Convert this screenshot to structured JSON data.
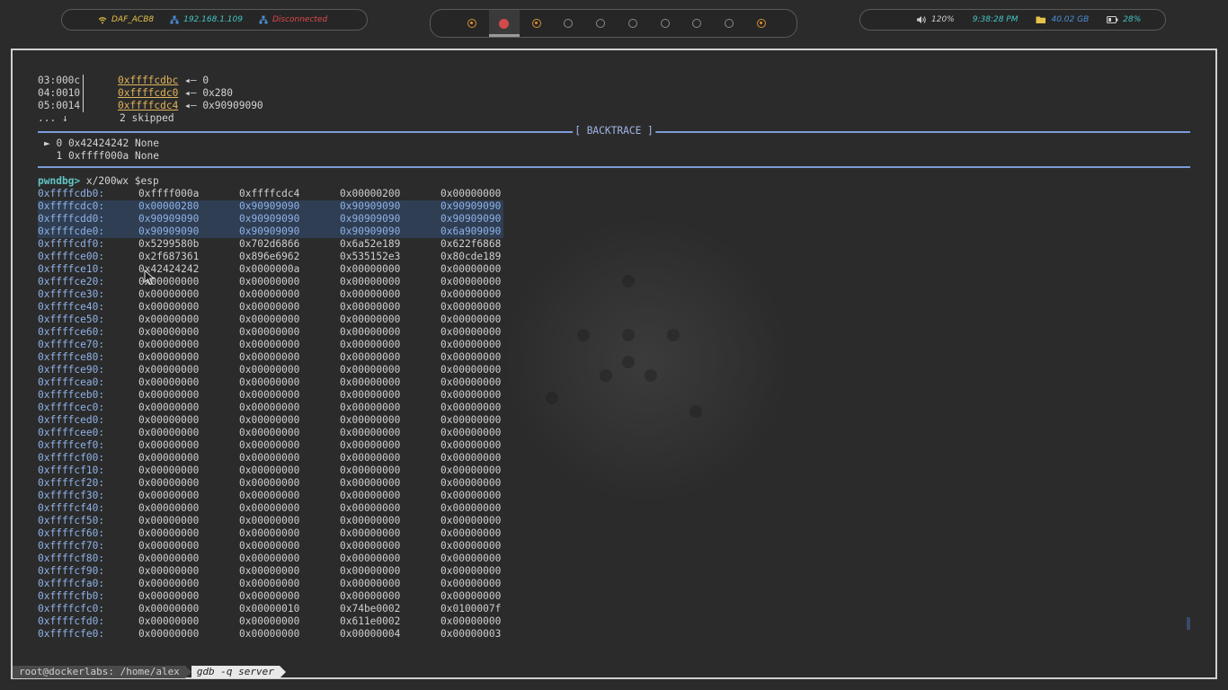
{
  "topbar": {
    "wifi_name": "DAF_ACB8",
    "ip": "192.168.1.109",
    "vpn_status": "Disconnected",
    "volume": "120%",
    "clock": "9:38:28 PM",
    "disk": "40.02 GB",
    "battery": "28%",
    "workspaces": [
      "occupied",
      "active",
      "occupied",
      "empty",
      "empty",
      "empty",
      "empty",
      "empty",
      "empty",
      "occupied"
    ]
  },
  "telescope": [
    {
      "idx": "03:000c",
      "addr": "0xffffcdbc",
      "value": "0"
    },
    {
      "idx": "04:0010",
      "addr": "0xffffcdc0",
      "value": "0x280"
    },
    {
      "idx": "05:0014",
      "addr": "0xffffcdc4",
      "value": "0x90909090"
    }
  ],
  "skipped": {
    "idx": "... ↓",
    "text": "2 skipped"
  },
  "backtrace": {
    "title": "[ BACKTRACE ]",
    "frames": [
      "► 0 0x42424242 None",
      "  1 0xffff000a None"
    ]
  },
  "prompt": {
    "label": "pwndbg>",
    "command": " x/200wx $esp"
  },
  "memory": [
    {
      "addr": "0xffffcdb0:",
      "vals": [
        "0xffff000a",
        "0xffffcdc4",
        "0x00000200",
        "0x00000000"
      ],
      "hl": false
    },
    {
      "addr": "0xffffcdc0:",
      "vals": [
        "0x00000280",
        "0x90909090",
        "0x90909090",
        "0x90909090"
      ],
      "hl": true
    },
    {
      "addr": "0xffffcdd0:",
      "vals": [
        "0x90909090",
        "0x90909090",
        "0x90909090",
        "0x90909090"
      ],
      "hl": true
    },
    {
      "addr": "0xffffcde0:",
      "vals": [
        "0x90909090",
        "0x90909090",
        "0x90909090",
        "0x6a909090"
      ],
      "hl": true
    },
    {
      "addr": "0xffffcdf0:",
      "vals": [
        "0x5299580b",
        "0x702d6866",
        "0x6a52e189",
        "0x622f6868"
      ],
      "hl": false
    },
    {
      "addr": "0xffffce00:",
      "vals": [
        "0x2f687361",
        "0x896e6962",
        "0x535152e3",
        "0x80cde189"
      ],
      "hl": false
    },
    {
      "addr": "0xffffce10:",
      "vals": [
        "0x42424242",
        "0x0000000a",
        "0x00000000",
        "0x00000000"
      ],
      "hl": false
    },
    {
      "addr": "0xffffce20:",
      "vals": [
        "0x00000000",
        "0x00000000",
        "0x00000000",
        "0x00000000"
      ],
      "hl": false
    },
    {
      "addr": "0xffffce30:",
      "vals": [
        "0x00000000",
        "0x00000000",
        "0x00000000",
        "0x00000000"
      ],
      "hl": false
    },
    {
      "addr": "0xffffce40:",
      "vals": [
        "0x00000000",
        "0x00000000",
        "0x00000000",
        "0x00000000"
      ],
      "hl": false
    },
    {
      "addr": "0xffffce50:",
      "vals": [
        "0x00000000",
        "0x00000000",
        "0x00000000",
        "0x00000000"
      ],
      "hl": false
    },
    {
      "addr": "0xffffce60:",
      "vals": [
        "0x00000000",
        "0x00000000",
        "0x00000000",
        "0x00000000"
      ],
      "hl": false
    },
    {
      "addr": "0xffffce70:",
      "vals": [
        "0x00000000",
        "0x00000000",
        "0x00000000",
        "0x00000000"
      ],
      "hl": false
    },
    {
      "addr": "0xffffce80:",
      "vals": [
        "0x00000000",
        "0x00000000",
        "0x00000000",
        "0x00000000"
      ],
      "hl": false
    },
    {
      "addr": "0xffffce90:",
      "vals": [
        "0x00000000",
        "0x00000000",
        "0x00000000",
        "0x00000000"
      ],
      "hl": false
    },
    {
      "addr": "0xffffcea0:",
      "vals": [
        "0x00000000",
        "0x00000000",
        "0x00000000",
        "0x00000000"
      ],
      "hl": false
    },
    {
      "addr": "0xffffceb0:",
      "vals": [
        "0x00000000",
        "0x00000000",
        "0x00000000",
        "0x00000000"
      ],
      "hl": false
    },
    {
      "addr": "0xffffcec0:",
      "vals": [
        "0x00000000",
        "0x00000000",
        "0x00000000",
        "0x00000000"
      ],
      "hl": false
    },
    {
      "addr": "0xffffced0:",
      "vals": [
        "0x00000000",
        "0x00000000",
        "0x00000000",
        "0x00000000"
      ],
      "hl": false
    },
    {
      "addr": "0xffffcee0:",
      "vals": [
        "0x00000000",
        "0x00000000",
        "0x00000000",
        "0x00000000"
      ],
      "hl": false
    },
    {
      "addr": "0xffffcef0:",
      "vals": [
        "0x00000000",
        "0x00000000",
        "0x00000000",
        "0x00000000"
      ],
      "hl": false
    },
    {
      "addr": "0xffffcf00:",
      "vals": [
        "0x00000000",
        "0x00000000",
        "0x00000000",
        "0x00000000"
      ],
      "hl": false
    },
    {
      "addr": "0xffffcf10:",
      "vals": [
        "0x00000000",
        "0x00000000",
        "0x00000000",
        "0x00000000"
      ],
      "hl": false
    },
    {
      "addr": "0xffffcf20:",
      "vals": [
        "0x00000000",
        "0x00000000",
        "0x00000000",
        "0x00000000"
      ],
      "hl": false
    },
    {
      "addr": "0xffffcf30:",
      "vals": [
        "0x00000000",
        "0x00000000",
        "0x00000000",
        "0x00000000"
      ],
      "hl": false
    },
    {
      "addr": "0xffffcf40:",
      "vals": [
        "0x00000000",
        "0x00000000",
        "0x00000000",
        "0x00000000"
      ],
      "hl": false
    },
    {
      "addr": "0xffffcf50:",
      "vals": [
        "0x00000000",
        "0x00000000",
        "0x00000000",
        "0x00000000"
      ],
      "hl": false
    },
    {
      "addr": "0xffffcf60:",
      "vals": [
        "0x00000000",
        "0x00000000",
        "0x00000000",
        "0x00000000"
      ],
      "hl": false
    },
    {
      "addr": "0xffffcf70:",
      "vals": [
        "0x00000000",
        "0x00000000",
        "0x00000000",
        "0x00000000"
      ],
      "hl": false
    },
    {
      "addr": "0xffffcf80:",
      "vals": [
        "0x00000000",
        "0x00000000",
        "0x00000000",
        "0x00000000"
      ],
      "hl": false
    },
    {
      "addr": "0xffffcf90:",
      "vals": [
        "0x00000000",
        "0x00000000",
        "0x00000000",
        "0x00000000"
      ],
      "hl": false
    },
    {
      "addr": "0xffffcfa0:",
      "vals": [
        "0x00000000",
        "0x00000000",
        "0x00000000",
        "0x00000000"
      ],
      "hl": false
    },
    {
      "addr": "0xffffcfb0:",
      "vals": [
        "0x00000000",
        "0x00000000",
        "0x00000000",
        "0x00000000"
      ],
      "hl": false
    },
    {
      "addr": "0xffffcfc0:",
      "vals": [
        "0x00000000",
        "0x00000010",
        "0x74be0002",
        "0x0100007f"
      ],
      "hl": false
    },
    {
      "addr": "0xffffcfd0:",
      "vals": [
        "0x00000000",
        "0x00000000",
        "0x611e0002",
        "0x00000000"
      ],
      "hl": false
    },
    {
      "addr": "0xffffcfe0:",
      "vals": [
        "0x00000000",
        "0x00000000",
        "0x00000004",
        "0x00000003"
      ],
      "hl": false
    }
  ],
  "statusbar": {
    "user_path": "root@dockerlabs: /home/alex",
    "command": "gdb -q server"
  }
}
